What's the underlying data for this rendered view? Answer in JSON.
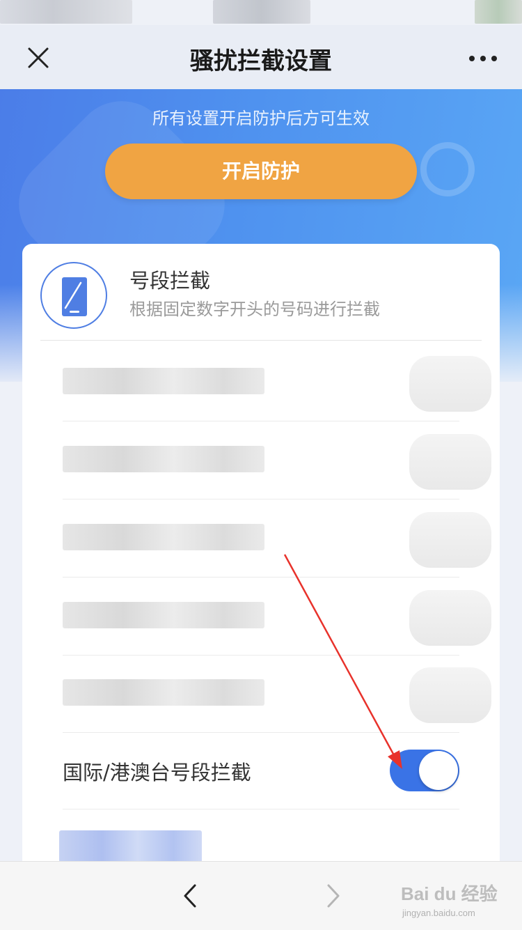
{
  "nav": {
    "title": "骚扰拦截设置"
  },
  "hero": {
    "note": "所有设置开启防护后方可生效",
    "button_label": "开启防护"
  },
  "card": {
    "title": "号段拦截",
    "subtitle": "根据固定数字开头的号码进行拦截",
    "intl_label": "国际/港澳台号段拦截",
    "intl_toggle_on": true
  },
  "watermark": {
    "text": "Bai du 经验",
    "sub": "jingyan.baidu.com"
  },
  "colors": {
    "accent": "#3a73e6",
    "button": "#f0a443",
    "hero": "#4f92ef"
  }
}
